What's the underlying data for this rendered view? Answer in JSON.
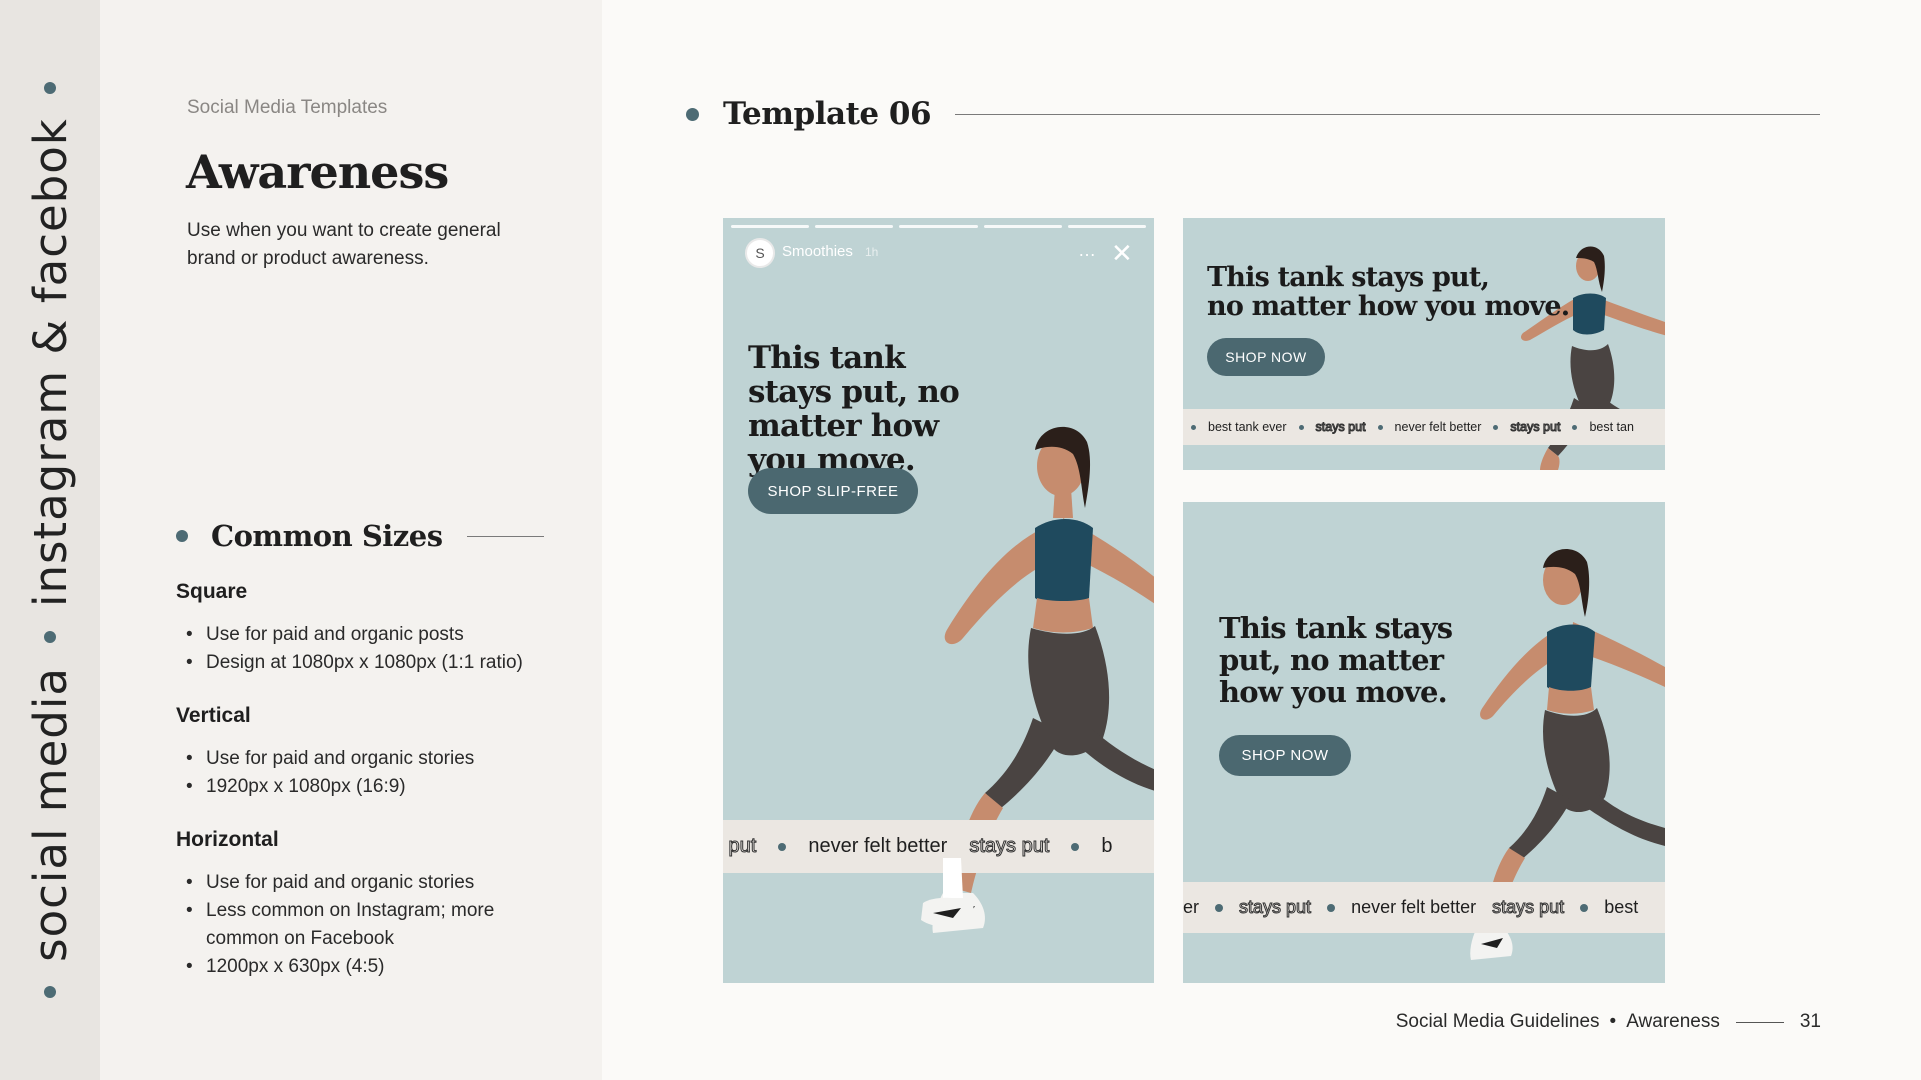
{
  "sidebar": {
    "vertical_label": "social media • instagram & facebok"
  },
  "strip": {
    "text_a": "social media",
    "text_b": "instagram & facebok"
  },
  "header": {
    "eyebrow": "Social Media Templates",
    "title": "Awareness",
    "description": "Use when you want to create general brand or product awareness."
  },
  "common_sizes": {
    "title": "Common Sizes",
    "groups": [
      {
        "name": "Square",
        "items": [
          "Use for paid and organic posts",
          "Design at 1080px x 1080px (1:1 ratio)"
        ]
      },
      {
        "name": "Vertical",
        "items": [
          "Use for paid and organic stories",
          "1920px x 1080px (16:9)"
        ]
      },
      {
        "name": "Horizontal",
        "items": [
          "Use for paid and organic stories",
          "Less common on Instagram; more common on Facebook",
          "1200px x 630px (4:5)"
        ]
      }
    ]
  },
  "template": {
    "title": "Template 06",
    "story": {
      "account": "Smoothies",
      "avatar_letter": "S",
      "time": "1h",
      "more": "…",
      "close": "✕",
      "headline": "This tank stays put, no matter how you move.",
      "cta": "SHOP SLIP-FREE",
      "ticker": [
        "s put",
        "never felt better",
        "stays put",
        "b"
      ]
    },
    "horizontal": {
      "headline_line1": "This tank stays put,",
      "headline_line2": "no matter how you move.",
      "cta": "SHOP NOW",
      "ticker": [
        "best tank ever",
        "stays put",
        "never felt better",
        "stays put",
        "best tan"
      ]
    },
    "square": {
      "headline": "This tank stays put, no matter how you move.",
      "cta": "SHOP NOW",
      "ticker": [
        "er",
        "stays put",
        "never felt better",
        "stays put",
        "best"
      ]
    }
  },
  "footer": {
    "doc": "Social Media Guidelines",
    "separator": "•",
    "section": "Awareness",
    "page": "31"
  },
  "colors": {
    "accent": "#4d6b74",
    "card_bg": "#bfd3d4",
    "button": "#4b6870",
    "ticker_bg": "#ebe7e2",
    "tank_top": "#1f4a5e",
    "shorts": "#4a4442"
  }
}
